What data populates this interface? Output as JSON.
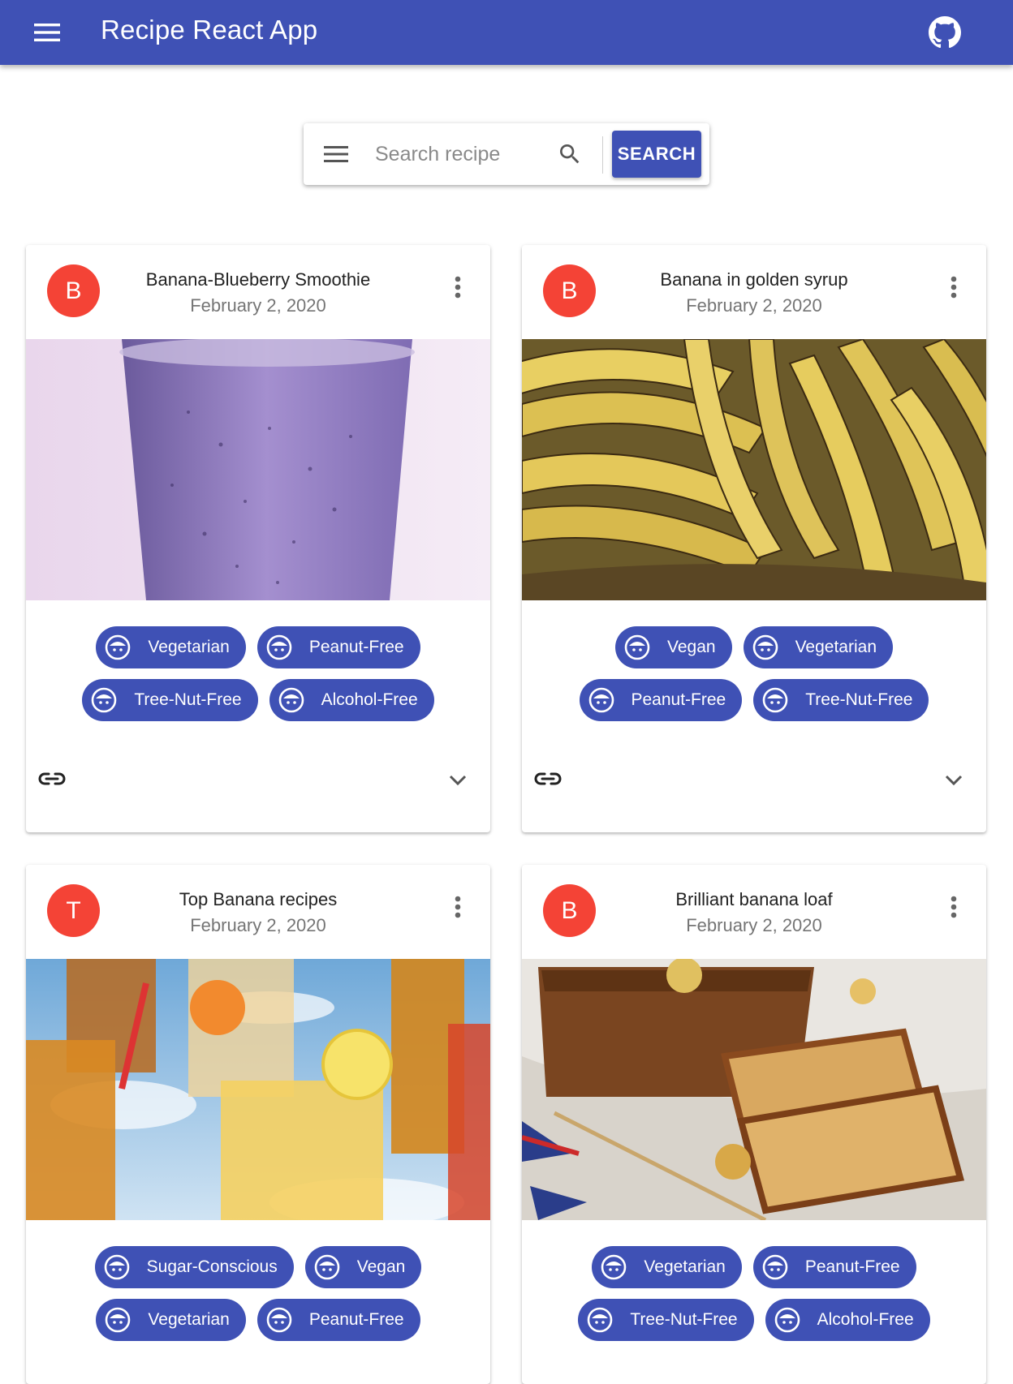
{
  "appbar": {
    "title": "Recipe React App",
    "menu_icon": "menu-icon",
    "github_icon": "github-icon",
    "color": "#3f51b5"
  },
  "search": {
    "placeholder": "Search recipe",
    "value": "",
    "button_label": "SEARCH",
    "menu_icon": "menu-icon",
    "search_icon": "search-icon"
  },
  "colors": {
    "primary": "#3f51b5",
    "avatar": "#f44336"
  },
  "cards": [
    {
      "avatar": "B",
      "title": "Banana-Blueberry Smoothie",
      "date": "February 2, 2020",
      "tags": [
        "Vegetarian",
        "Peanut-Free",
        "Tree-Nut-Free",
        "Alcohol-Free"
      ]
    },
    {
      "avatar": "B",
      "title": "Banana in golden syrup",
      "date": "February 2, 2020",
      "tags": [
        "Vegan",
        "Vegetarian",
        "Peanut-Free",
        "Tree-Nut-Free"
      ]
    },
    {
      "avatar": "T",
      "title": "Top Banana recipes",
      "date": "February 2, 2020",
      "tags": [
        "Sugar-Conscious",
        "Vegan",
        "Vegetarian",
        "Peanut-Free"
      ]
    },
    {
      "avatar": "B",
      "title": "Brilliant banana loaf",
      "date": "February 2, 2020",
      "tags": [
        "Vegetarian",
        "Peanut-Free",
        "Tree-Nut-Free",
        "Alcohol-Free"
      ]
    }
  ]
}
